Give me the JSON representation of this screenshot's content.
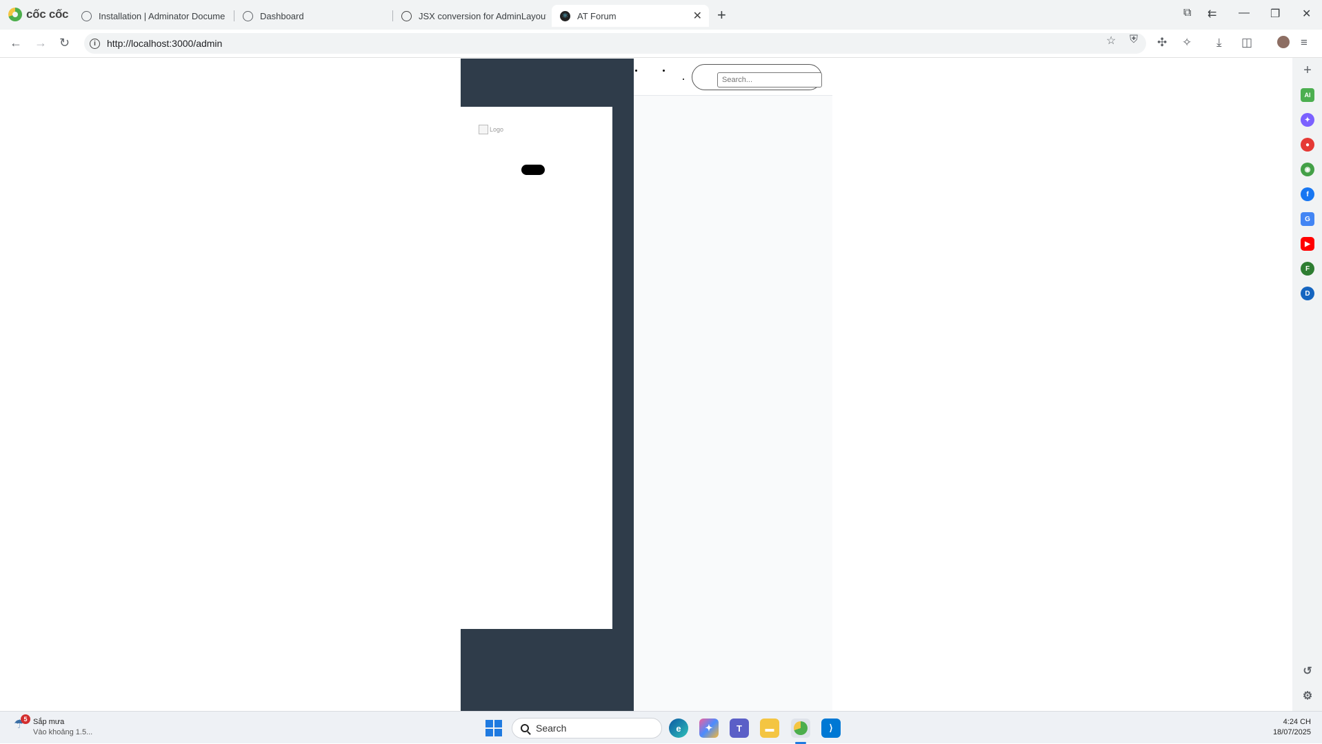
{
  "browser": {
    "brand": "cốc cốc",
    "tabs": [
      {
        "title": "Installation | Adminator Docume",
        "active": false,
        "icon": "globe-icon"
      },
      {
        "title": "Dashboard",
        "active": false,
        "icon": "globe-icon"
      },
      {
        "title": "JSX conversion for AdminLayout",
        "active": false,
        "icon": "chatgpt-icon"
      },
      {
        "title": "AT Forum",
        "active": true,
        "icon": "react-icon"
      }
    ],
    "url": "http://localhost:3000/admin"
  },
  "page": {
    "logo_alt": "Logo",
    "search_placeholder": "Search...",
    "sidebar_color": "#2f3c4a",
    "content_bg": "#f9fafb"
  },
  "sidebar_rail": {
    "icons": [
      "ai-icon",
      "messenger-icon",
      "notification-icon",
      "gamepad-icon",
      "facebook-icon",
      "translate-icon",
      "youtube-icon",
      "profile-f-icon",
      "profile-d-icon",
      "history-icon",
      "settings-icon"
    ],
    "rail_labels": [
      "AI",
      "F",
      "D"
    ]
  },
  "taskbar": {
    "weather_title": "Sắp mưa",
    "weather_sub": "Vào khoảng 1.5...",
    "weather_badge": "5",
    "search_label": "Search",
    "time": "4:24 CH",
    "date": "18/07/2025"
  }
}
